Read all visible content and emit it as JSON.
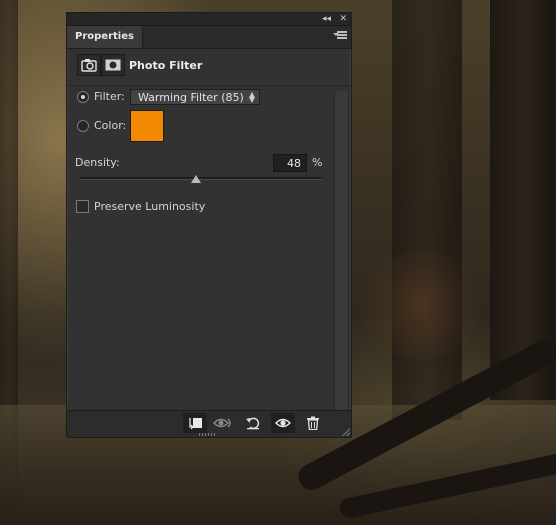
{
  "panel": {
    "tab_label": "Properties",
    "collapse_glyph": "◂◂",
    "close_glyph": "✕",
    "adjustment_title": "Photo Filter"
  },
  "filter": {
    "radio_label": "Filter:",
    "selected_option": "Warming Filter (85)",
    "selected": true
  },
  "color": {
    "radio_label": "Color:",
    "swatch_hex": "#f28900",
    "selected": false
  },
  "density": {
    "label": "Density:",
    "value": "48",
    "unit": "%",
    "slider_fraction": 0.48
  },
  "preserve_luminosity": {
    "label": "Preserve Luminosity",
    "checked": false
  },
  "footer_icons": [
    "clip-to-layer-icon",
    "view-previous-state-icon",
    "reset-icon",
    "visibility-eye-icon",
    "trash-icon"
  ],
  "colors": {
    "panel_bg": "#323232",
    "accent_swatch": "#f28900"
  }
}
